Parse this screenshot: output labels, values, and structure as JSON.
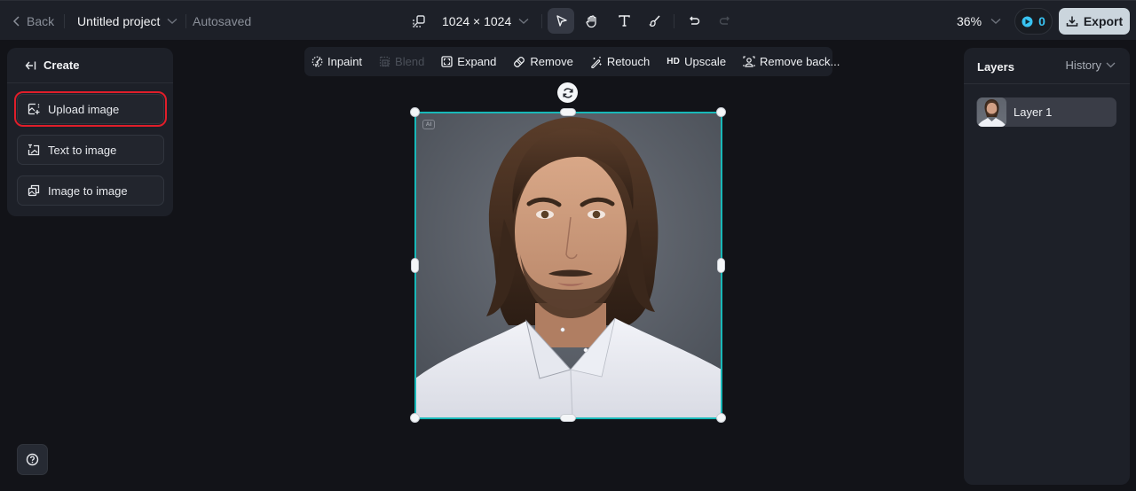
{
  "topbar": {
    "back_label": "Back",
    "project_name": "Untitled project",
    "save_status": "Autosaved",
    "canvas_size": "1024 × 1024",
    "tools": [
      {
        "name": "select",
        "active": true
      },
      {
        "name": "hand",
        "active": false
      },
      {
        "name": "text",
        "active": false
      },
      {
        "name": "brush",
        "active": false
      }
    ],
    "zoom_level": "36%",
    "credits": "0",
    "export_label": "Export"
  },
  "left_panel": {
    "title": "Create",
    "items": [
      {
        "label": "Upload image",
        "icon": "upload-image-icon",
        "highlighted": true
      },
      {
        "label": "Text to image",
        "icon": "text-to-image-icon",
        "highlighted": false
      },
      {
        "label": "Image to image",
        "icon": "image-to-image-icon",
        "highlighted": false
      }
    ]
  },
  "edit_toolbar": {
    "items": [
      {
        "label": "Inpaint",
        "icon": "inpaint-icon",
        "enabled": true
      },
      {
        "label": "Blend",
        "icon": "blend-icon",
        "enabled": false
      },
      {
        "label": "Expand",
        "icon": "expand-icon",
        "enabled": true
      },
      {
        "label": "Remove",
        "icon": "eraser-icon",
        "enabled": true
      },
      {
        "label": "Retouch",
        "icon": "magic-wand-icon",
        "enabled": true
      },
      {
        "label": "Upscale",
        "badge": "HD",
        "enabled": true
      },
      {
        "label": "Remove back...",
        "icon": "remove-background-icon",
        "enabled": true
      }
    ]
  },
  "canvas": {
    "ai_badge": "AI",
    "image_description": "AI-generated portrait of a man with shoulder-length brown hair and beard in a white shirt"
  },
  "right_panel": {
    "title": "Layers",
    "history_label": "History",
    "layers": [
      {
        "name": "Layer 1"
      }
    ]
  },
  "colors": {
    "accent_selection": "#18b8b8",
    "highlight_outline": "#e01e2a",
    "credit_accent": "#39c3f2",
    "export_bg": "#cbd5dd"
  }
}
